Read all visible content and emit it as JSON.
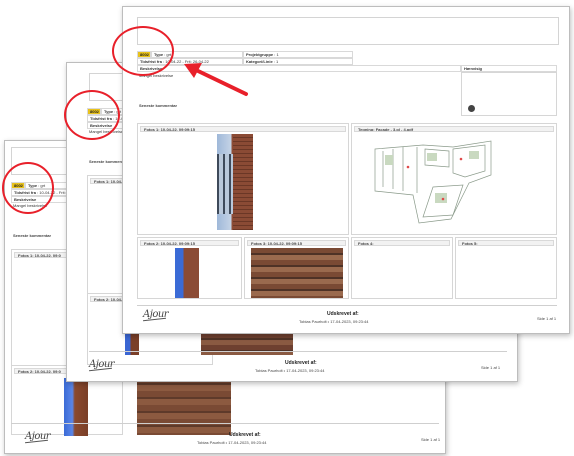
{
  "report": {
    "badge": "8002",
    "type_label": "Type",
    "type_value": ": grt",
    "deadline_label": "Tidsfrist fra",
    "deadline_value": ": 10-04-22 - Frit: 26-04-22",
    "project_label": "Projektgruppe",
    "project_value": ": 1",
    "category_label": "Kategori/Linie",
    "category_value": ": 1",
    "description_label": "Beskrivelse",
    "description_value": "Mangel beskrivelse",
    "note_label": "Hænvisig",
    "comment_label": "Seneste kommentar",
    "photo_main_label": "Fotos 1: 10-04-22, 09:09:15",
    "drawing_label": "Tegning: Facade - 3.pl - 4.pdf",
    "photo2_label": "Fotos 2: 10-04-22, 09:09:15",
    "photo3_label": "Fotos 3: 10-04-22, 09:09:15",
    "photo4_label": "Fotos 4:",
    "photo5_label": "Fotos 5:",
    "footer_title": "Udskrevet af:",
    "footer_sub": "Tobias Paurholt • 17-04-2023, 09:23:44",
    "page_num": "Side 1 af 1",
    "logo": "Ajour",
    "back_photo1_label": "Fotos 1: 10-04-22, 09:0",
    "back_photo2_label": "Fotos 2: 10-04-22, 09:0"
  },
  "annotation_color": "#e8202a",
  "badge_color": "#e9c21b"
}
